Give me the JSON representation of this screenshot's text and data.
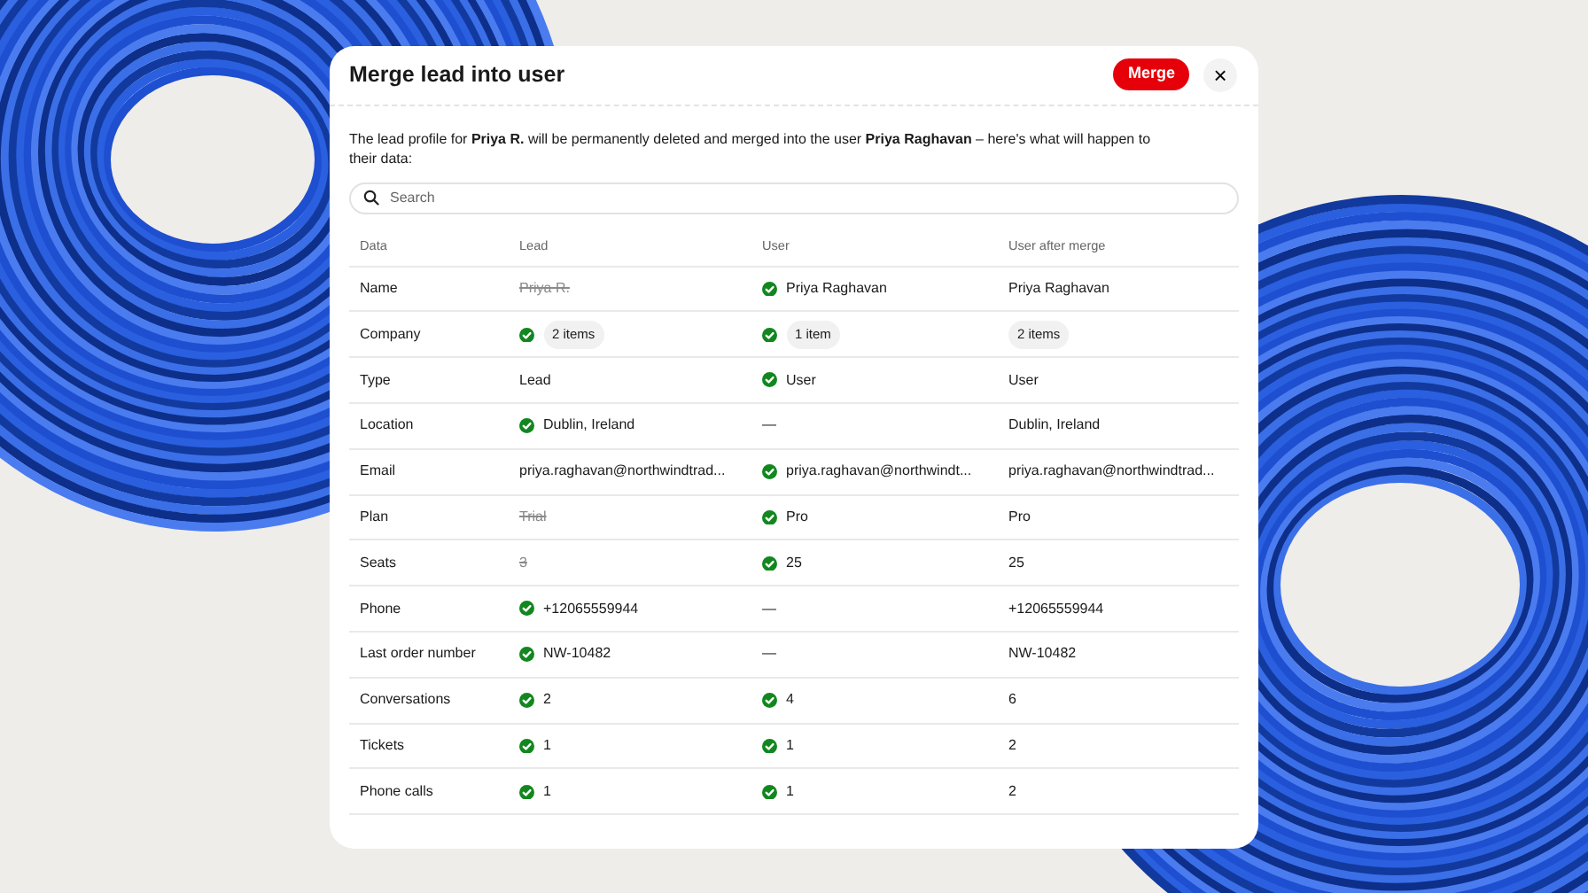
{
  "dialog": {
    "title": "Merge lead into user",
    "merge_button": "Merge",
    "close_button": "×"
  },
  "description": "The lead profile for **Priya R.** will be permanently deleted and merged into the user **Priya Raghavan** – here's what will happen to their data:",
  "search": {
    "placeholder": "Search"
  },
  "table": {
    "columns": [
      "Data",
      "Lead",
      "User",
      "User after merge"
    ],
    "rows": [
      {
        "label": "Name",
        "cells": [
          {
            "kind": "text",
            "text": "Priya R.",
            "kept": false,
            "struck": true
          },
          {
            "kind": "text",
            "text": "Priya Raghavan",
            "kept": true,
            "struck": false
          },
          {
            "kind": "text",
            "text": "Priya Raghavan",
            "kept": false,
            "struck": false
          }
        ]
      },
      {
        "label": "Company",
        "cells": [
          {
            "kind": "pill",
            "text": "2 items",
            "kept": true,
            "struck": false
          },
          {
            "kind": "pill",
            "text": "1 item",
            "kept": true,
            "struck": false
          },
          {
            "kind": "pill",
            "text": "2 items",
            "kept": false,
            "struck": false
          }
        ]
      },
      {
        "label": "Type",
        "cells": [
          {
            "kind": "text",
            "text": "Lead",
            "kept": false,
            "struck": false
          },
          {
            "kind": "text",
            "text": "User",
            "kept": true,
            "struck": false
          },
          {
            "kind": "text",
            "text": "User",
            "kept": false,
            "struck": false
          }
        ]
      },
      {
        "label": "Location",
        "cells": [
          {
            "kind": "text",
            "text": "Dublin, Ireland",
            "kept": true,
            "struck": false
          },
          {
            "kind": "text",
            "text": "—",
            "kept": false,
            "struck": false
          },
          {
            "kind": "text",
            "text": "Dublin, Ireland",
            "kept": false,
            "struck": false
          }
        ]
      },
      {
        "label": "Email",
        "cells": [
          {
            "kind": "text",
            "text": "priya.raghavan@northwindtrad...",
            "kept": false,
            "struck": false
          },
          {
            "kind": "text",
            "text": "priya.raghavan@northwindt...",
            "kept": true,
            "struck": false
          },
          {
            "kind": "text",
            "text": "priya.raghavan@northwindtrad...",
            "kept": false,
            "struck": false
          }
        ]
      },
      {
        "label": "Plan",
        "cells": [
          {
            "kind": "text",
            "text": "Trial",
            "kept": false,
            "struck": true
          },
          {
            "kind": "text",
            "text": "Pro",
            "kept": true,
            "struck": false
          },
          {
            "kind": "text",
            "text": "Pro",
            "kept": false,
            "struck": false
          }
        ]
      },
      {
        "label": "Seats",
        "cells": [
          {
            "kind": "text",
            "text": "3",
            "kept": false,
            "struck": true
          },
          {
            "kind": "text",
            "text": "25",
            "kept": true,
            "struck": false
          },
          {
            "kind": "text",
            "text": "25",
            "kept": false,
            "struck": false
          }
        ]
      },
      {
        "label": "Phone",
        "cells": [
          {
            "kind": "text",
            "text": "+12065559944",
            "kept": true,
            "struck": false
          },
          {
            "kind": "text",
            "text": "—",
            "kept": false,
            "struck": false
          },
          {
            "kind": "text",
            "text": "+12065559944",
            "kept": false,
            "struck": false
          }
        ]
      },
      {
        "label": "Last order number",
        "cells": [
          {
            "kind": "text",
            "text": "NW-10482",
            "kept": true,
            "struck": false
          },
          {
            "kind": "text",
            "text": "—",
            "kept": false,
            "struck": false
          },
          {
            "kind": "text",
            "text": "NW-10482",
            "kept": false,
            "struck": false
          }
        ]
      },
      {
        "label": "Conversations",
        "cells": [
          {
            "kind": "text",
            "text": "2",
            "kept": true,
            "struck": false
          },
          {
            "kind": "text",
            "text": "4",
            "kept": true,
            "struck": false
          },
          {
            "kind": "text",
            "text": "6",
            "kept": false,
            "struck": false
          }
        ]
      },
      {
        "label": "Tickets",
        "cells": [
          {
            "kind": "text",
            "text": "1",
            "kept": true,
            "struck": false
          },
          {
            "kind": "text",
            "text": "1",
            "kept": true,
            "struck": false
          },
          {
            "kind": "text",
            "text": "2",
            "kept": false,
            "struck": false
          }
        ]
      },
      {
        "label": "Phone calls",
        "cells": [
          {
            "kind": "text",
            "text": "1",
            "kept": true,
            "struck": false
          },
          {
            "kind": "text",
            "text": "1",
            "kept": true,
            "struck": false
          },
          {
            "kind": "text",
            "text": "2",
            "kept": false,
            "struck": false
          }
        ]
      }
    ]
  }
}
